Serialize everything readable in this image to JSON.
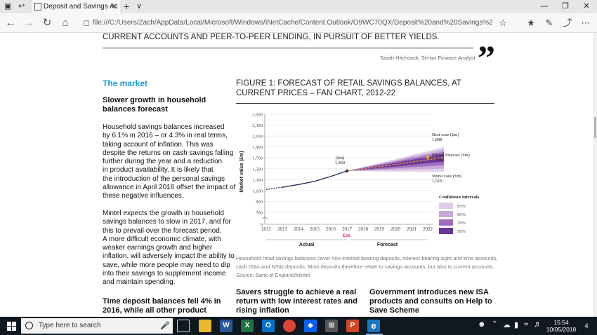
{
  "browser": {
    "tab_title": "Deposit and Savings Ac",
    "url": "file:///C:/Users/Zach/AppData/Local/Microsoft/Windows/INetCache/Content.Outlook/O9WC70QX/Deposit%20and%20Savings%20Accounts%20-%20UK%20"
  },
  "document": {
    "header_text": "CURRENT ACCOUNTS AND PEER-TO-PEER LENDING, IN PURSUIT OF BETTER YIELDS.",
    "author": "Sarah Hitchcock, Senior Finance Analyst",
    "quote_glyph": "”",
    "section_title": "The market",
    "sub1": "Slower growth in household balances forecast",
    "para1": [
      "Household savings balances increased",
      "by 6.1% in 2016 – or 4.3% in real terms,",
      "taking account of inflation. This was",
      "despite the returns on cash savings falling",
      "further during the year and a reduction",
      "in product availability. It is likely that",
      "the introduction of the personal savings",
      "allowance in April 2016 offset the impact of",
      "these negative influences."
    ],
    "para2": [
      "Mintel expects the growth in household",
      "savings balances to slow in 2017, and for",
      "this to prevail over the forecast period.",
      "A more difficult economic climate, with",
      "weaker earnings growth and higher",
      "inflation, will adversely impact the ability to",
      "save, while more people may need to dip",
      "into their savings to supplement income",
      "and maintain spending."
    ],
    "sub2": "Time deposit balances fell 4% in 2016, while all other product",
    "figure_title": "FIGURE 1: FORECAST OF RETAIL SAVINGS BALANCES, AT CURRENT PRICES – FAN CHART, 2012-22",
    "caption": [
      "Household retail savings balances cover non-interest bearing deposits, interest-bearing sight and time accounts,",
      "cash ISAs and NS&I deposits. Most deposits therefore relate to savings accounts, but also to current accounts.",
      "Source: Bank of England/Mintel"
    ],
    "col2_heading": "Savers struggle to achieve a real return with low interest rates and rising inflation",
    "col3_heading": "Government introduces new ISA products and consults on Help to Save Scheme"
  },
  "chart_data": {
    "type": "line",
    "title": "FIGURE 1: FORECAST OF RETAIL SAVINGS BALANCES, AT CURRENT PRICES – FAN CHART, 2012-22",
    "ylabel": "Market value (£m)",
    "ylim": [
      0,
      2500
    ],
    "yticks": [
      "0",
      "700",
      "900",
      "1,100",
      "1,300",
      "1,500",
      "1,700",
      "1,900",
      "2,100",
      "2,300",
      "2,500"
    ],
    "x": [
      "2012",
      "2013",
      "2014",
      "2015",
      "2016",
      "2017",
      "2018",
      "2019",
      "2020",
      "2021",
      "2022"
    ],
    "actual_values": [
      1120,
      1160,
      1210,
      1270,
      1360,
      1460
    ],
    "forecast_values": [
      1460,
      1500,
      1540,
      1580,
      1625,
      1665,
      1709
    ],
    "best_case": 1898,
    "worst_case": 1519,
    "point_label_unit": "(£m)",
    "point_label_value": "1,460",
    "annot_best_label": "Best case (£m)",
    "annot_best_value": "1,898",
    "annot_mintel_label": "Mintel forecast (£m)",
    "annot_mintel_value": "1,709",
    "annot_worst_label": "Worst case (£m)",
    "annot_worst_value": "1,519",
    "est_label": "Est.",
    "actual_label": "Actual",
    "forecast_label": "Forecast",
    "legend_title": "Confidence intervals",
    "legend": [
      {
        "label": "95%",
        "color": "#e0cde9"
      },
      {
        "label": "90%",
        "color": "#c8a7d9"
      },
      {
        "label": "70%",
        "color": "#9e6dbf"
      },
      {
        "label": "50%",
        "color": "#6a3594"
      }
    ],
    "colors": {
      "line": "#1f2a5c",
      "forecast": "#f5a623",
      "est": "#e0218a"
    }
  },
  "taskbar": {
    "search_placeholder": "Type here to search",
    "time": "15:54",
    "date": "10/05/2018",
    "notif_count": "4"
  }
}
